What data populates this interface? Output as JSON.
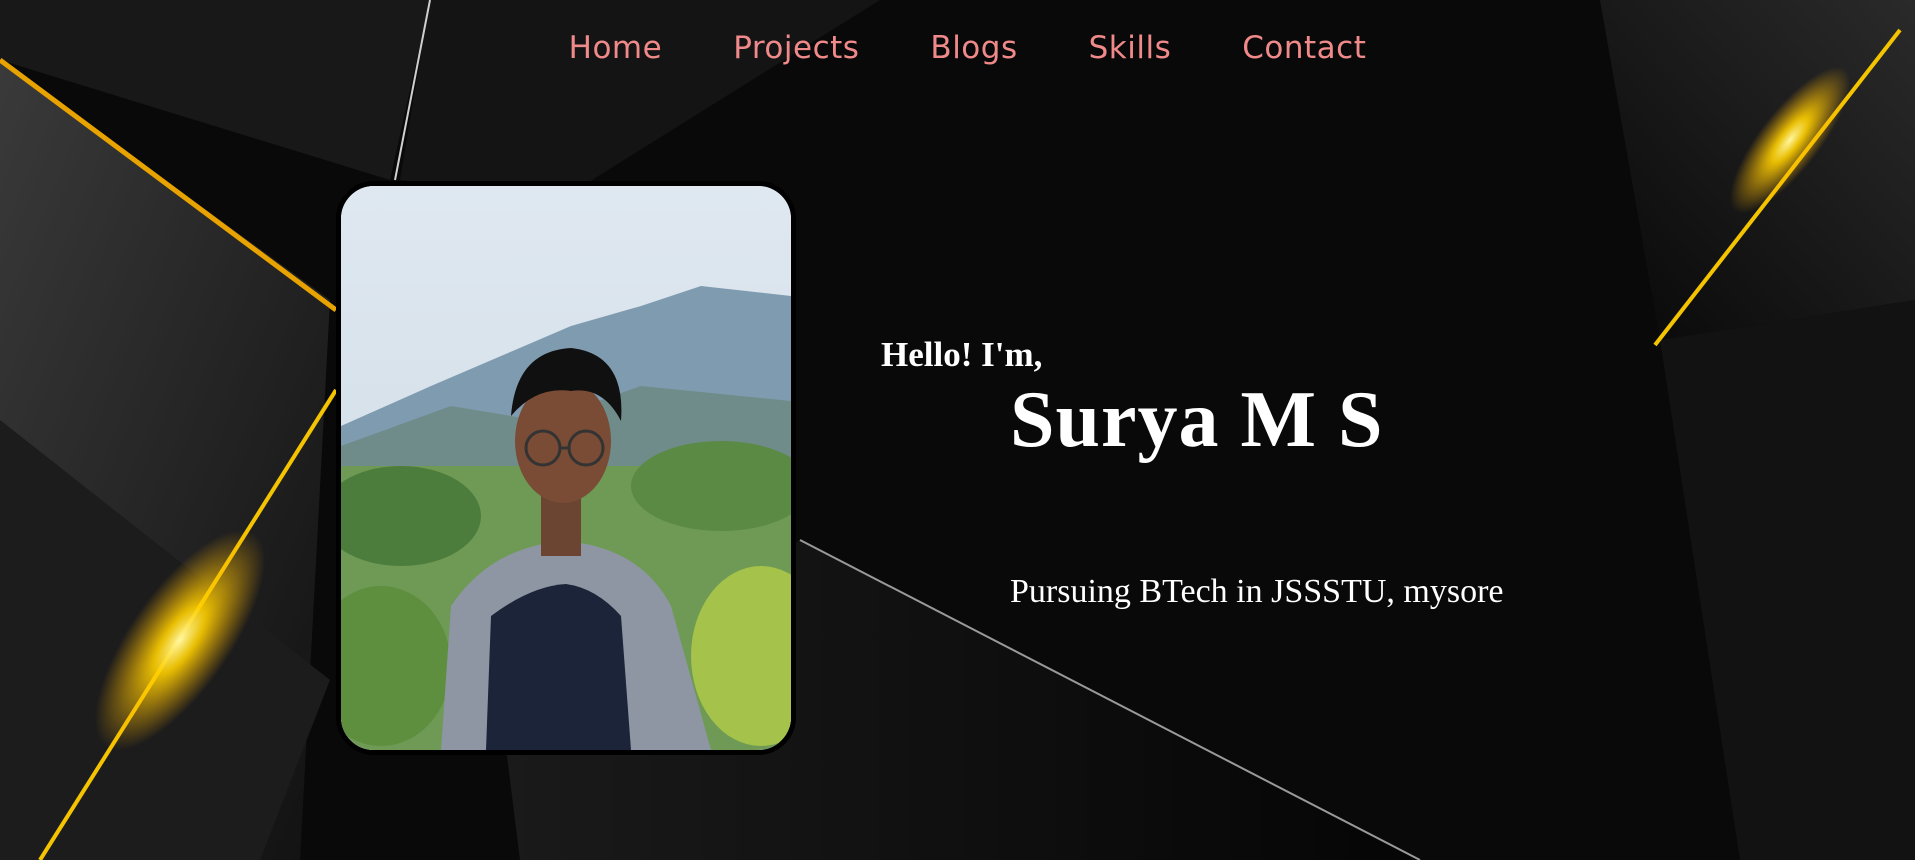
{
  "nav": {
    "items": [
      {
        "label": "Home"
      },
      {
        "label": "Projects"
      },
      {
        "label": "Blogs"
      },
      {
        "label": "Skills"
      },
      {
        "label": "Contact"
      }
    ]
  },
  "hero": {
    "greeting": "Hello! I'm,",
    "name": "Surya M S",
    "tagline": "Pursuing BTech in JSSSTU, mysore",
    "photo_alt": "profile-photo"
  },
  "colors": {
    "nav_link": "#f08a8a",
    "background": "#0a0a0a",
    "accent_gold": "#f5c400",
    "text": "#ffffff"
  }
}
